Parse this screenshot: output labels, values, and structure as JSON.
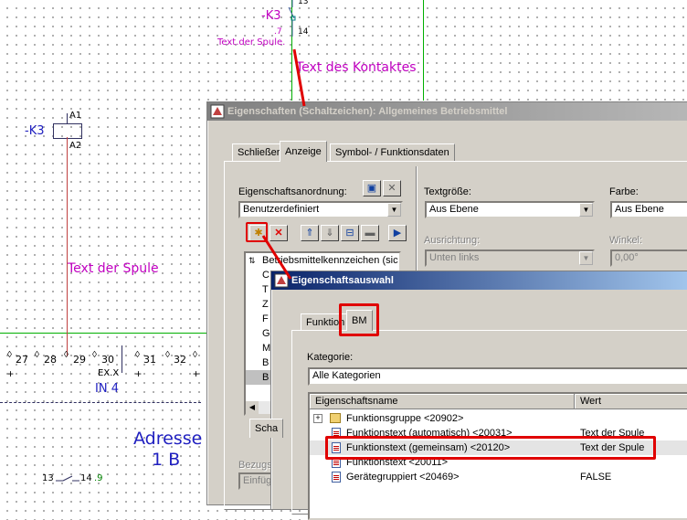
{
  "cad": {
    "k3_top": "-K3",
    "pin13": "13",
    "pin14": "14",
    "dot7": ".7",
    "text_der_spule_small": "Text.der Spule.",
    "text_des_kontaktes": "Text des Kontaktes",
    "k3_left": "-K3",
    "a1": "A1",
    "a2": "A2",
    "text_der_spule": "Text der Spule",
    "terminals": [
      "27",
      "28",
      "29",
      "30",
      "31",
      "32"
    ],
    "ex_x": "EX.X",
    "in4": "IN 4",
    "adresse": "Adresse",
    "one_b": "1 B",
    "bottom_13": "13",
    "bottom_14": "14",
    "bottom_9": ".9"
  },
  "dialog1": {
    "title": "Eigenschaften (Schaltzeichen): Allgemeines Betriebsmittel",
    "tabs": [
      "Schließer",
      "Anzeige",
      "Symbol- / Funktionsdaten"
    ],
    "eigenschaftsanordnung_label": "Eigenschaftsanordnung:",
    "anordnung_value": "Benutzerdefiniert",
    "textgroesse_label": "Textgröße:",
    "textgroesse_value": "Aus Ebene",
    "farbe_label": "Farbe:",
    "farbe_value": "Aus Ebene",
    "ausrichtung_label": "Ausrichtung:",
    "ausrichtung_value": "Unten links",
    "winkel_label": "Winkel:",
    "winkel_value": "0,00°",
    "list_items": [
      "Betriebsmittelkennzeichen (sic",
      "C",
      "T",
      "Z",
      "F",
      "G",
      "M",
      "B",
      "B"
    ],
    "sub_tab": "Scha",
    "bezugs_label": "Bezugs",
    "einfueg_value": "Einfüg"
  },
  "dialog2": {
    "title": "Eigenschaftsauswahl",
    "tabs": [
      "Funktion",
      "BM"
    ],
    "kategorie_label": "Kategorie:",
    "kategorie_value": "Alle Kategorien",
    "col_name": "Eigenschaftsname",
    "col_value": "Wert",
    "rows": [
      {
        "name": "Funktionsgruppe <20902>",
        "value": ""
      },
      {
        "name": "Funktionstext (automatisch) <20031>",
        "value": "Text der Spule"
      },
      {
        "name": "Funktionstext (gemeinsam) <20120>",
        "value": "Text der Spule"
      },
      {
        "name": "Funktionstext <20011>",
        "value": ""
      },
      {
        "name": "Gerätegruppiert <20469>",
        "value": "FALSE"
      }
    ]
  },
  "colors": {
    "cad_magenta": "#c000c0",
    "cad_blue": "#2020c0",
    "highlight_red": "#e00000",
    "green_line": "#00b000",
    "window_face": "#d4d0c8"
  }
}
